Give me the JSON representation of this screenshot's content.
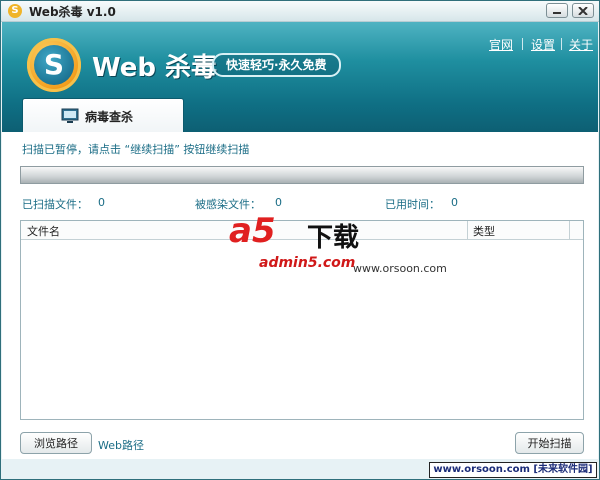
{
  "window": {
    "title": "Web杀毒 v1.0"
  },
  "header": {
    "logo_letter": "S",
    "brand": "Web 杀毒",
    "slogan": "快速轻巧·永久免费",
    "links": [
      "官网",
      "设置",
      "关于"
    ]
  },
  "tabs": [
    {
      "label": "病毒查杀",
      "icon": "monitor-icon",
      "active": true
    }
  ],
  "scan": {
    "status_message": "扫描已暂停，请点击 “继续扫描” 按钮继续扫描",
    "progress": 0,
    "stats": [
      {
        "label": "已扫描文件：",
        "value": "0"
      },
      {
        "label": "被感染文件：",
        "value": "0"
      },
      {
        "label": "已用时间：",
        "value": "0"
      }
    ]
  },
  "table": {
    "columns": [
      "文件名",
      "类型"
    ],
    "rows": []
  },
  "footer": {
    "browse_button": "浏览路径",
    "path_label": "Web路径",
    "start_button": "开始扫描"
  },
  "watermarks": {
    "logo_a5": "a5",
    "logo_download": "下载",
    "logo_site": "admin5.com",
    "overlay_url": "www.orsoon.com",
    "bottom_label": "www.orsoon.com [未来软件园]"
  },
  "colors": {
    "header_top": "#4fb3c2",
    "header_bottom": "#0d5f73",
    "link_text": "#1b6d86",
    "watermark_red": "#e02020"
  }
}
